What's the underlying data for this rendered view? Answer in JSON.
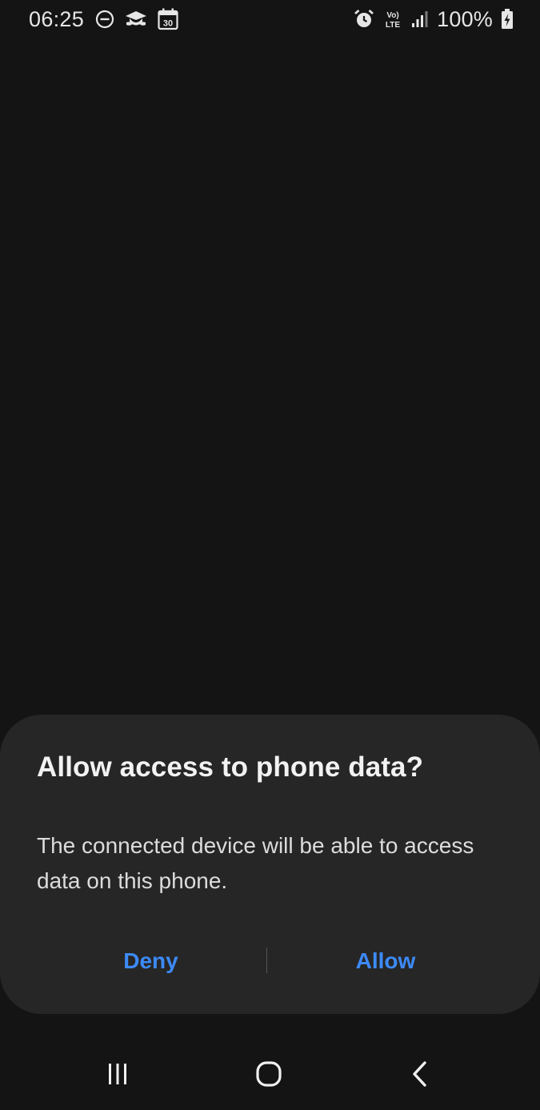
{
  "status_bar": {
    "time": "06:25",
    "left_icons": [
      "do-not-disturb-icon",
      "app-notification-icon",
      "calendar-icon"
    ],
    "calendar_day": "30",
    "right_icons": [
      "alarm-icon",
      "volte-icon",
      "signal-icon",
      "battery-charging-icon"
    ],
    "volte_line1": "Vo)",
    "volte_line2": "LTE",
    "battery_percent": "100%"
  },
  "dialog": {
    "title": "Allow access to phone data?",
    "message": "The connected device will be able to access data on this phone.",
    "deny_label": "Deny",
    "allow_label": "Allow"
  },
  "nav_bar": {
    "buttons": [
      "recents-icon",
      "home-icon",
      "back-icon"
    ]
  },
  "colors": {
    "background": "#141414",
    "dialog_background": "#262626",
    "accent": "#3d8af7",
    "text_primary": "#f2f2f2",
    "text_secondary": "#dcdcdc"
  }
}
